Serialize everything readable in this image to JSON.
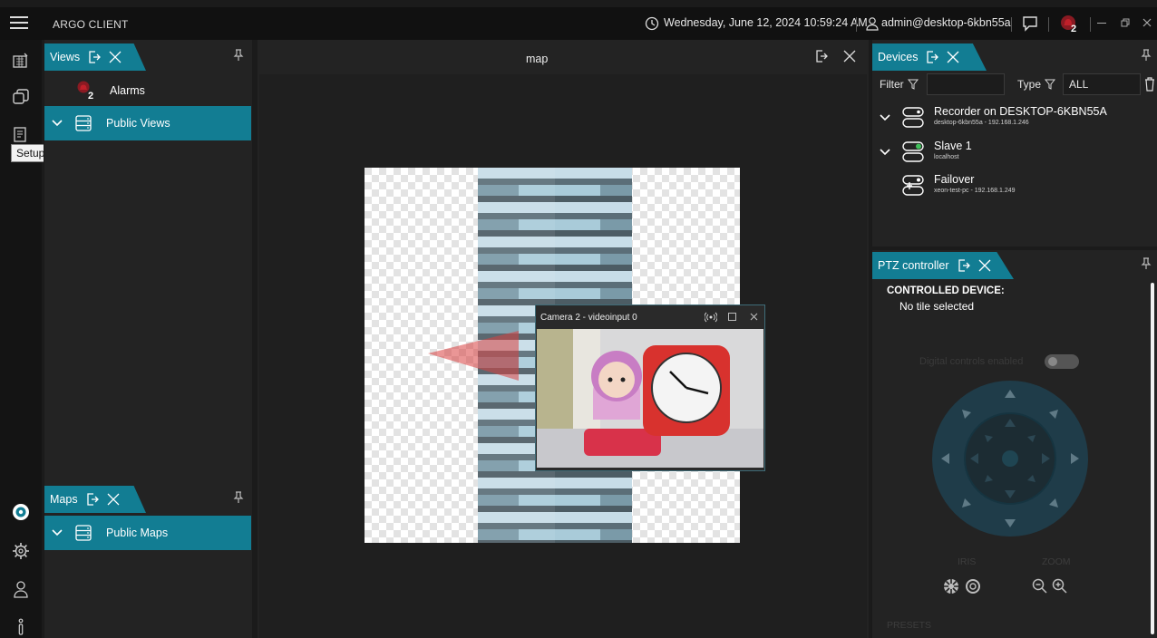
{
  "app": {
    "title": "ARGO CLIENT"
  },
  "header": {
    "datetime": "Wednesday, June 12, 2024 10:59:24 AM",
    "user": "admin@desktop-6kbn55a",
    "alarm_count": "2"
  },
  "rail": {
    "tooltip": "Setup Mode"
  },
  "views": {
    "tab_label": "Views",
    "items": [
      {
        "label": "Alarms",
        "badge": "2"
      },
      {
        "label": "Public Views"
      }
    ]
  },
  "maps": {
    "tab_label": "Maps",
    "items": [
      {
        "label": "Public Maps"
      }
    ]
  },
  "map": {
    "title": "map",
    "camera_popup": {
      "title": "Camera 2 - videoinput 0"
    }
  },
  "devices": {
    "tab_label": "Devices",
    "filter_label": "Filter",
    "filter_value": "",
    "type_label": "Type",
    "type_value": "ALL",
    "items": [
      {
        "name": "Recorder on DESKTOP-6KBN55A",
        "sub": "desktop-6kbn55a - 192.168.1.246"
      },
      {
        "name": "Slave 1",
        "sub": "localhost"
      },
      {
        "name": "Failover",
        "sub": "xeon-test-pc - 192.168.1.249"
      }
    ]
  },
  "ptz": {
    "tab_label": "PTZ controller",
    "controlled_device_label": "CONTROLLED DEVICE:",
    "controlled_device_value": "No tile selected",
    "digital_controls_label": "Digital controls enabled",
    "iris_label": "IRIS",
    "zoom_label": "ZOOM",
    "presets_label": "PRESETS"
  },
  "colors": {
    "accent": "#127d93",
    "background": "#1b1b1b",
    "panel": "#232323",
    "alarm_red": "#c0202a"
  }
}
